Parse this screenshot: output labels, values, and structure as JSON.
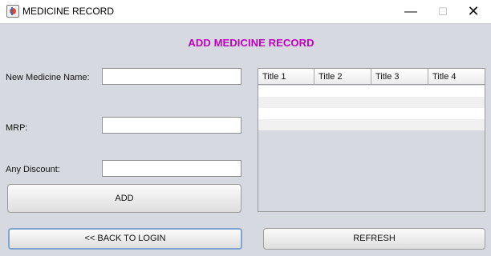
{
  "window": {
    "title": "MEDICINE RECORD",
    "controls": {
      "minimize": "—",
      "maximize": "☐",
      "close": "✕"
    }
  },
  "form": {
    "heading": "ADD MEDICINE RECORD",
    "name_label": "New Medicine Name:",
    "name_value": "",
    "mrp_label": "MRP:",
    "mrp_value": "",
    "discount_label": "Any Discount:",
    "discount_value": "",
    "add_button": "ADD"
  },
  "table": {
    "columns": [
      "Title 1",
      "Title 2",
      "Title 3",
      "Title 4"
    ],
    "rows": [
      [
        "",
        "",
        "",
        ""
      ],
      [
        "",
        "",
        "",
        ""
      ],
      [
        "",
        "",
        "",
        ""
      ],
      [
        "",
        "",
        "",
        ""
      ]
    ]
  },
  "footer": {
    "back_button": "<< BACK TO LOGIN",
    "refresh_button": "REFRESH"
  },
  "colors": {
    "heading": "#c000c0",
    "panel_bg": "#d6d9df",
    "row_white": "#ffffff",
    "row_alt": "#f0f0f0"
  }
}
